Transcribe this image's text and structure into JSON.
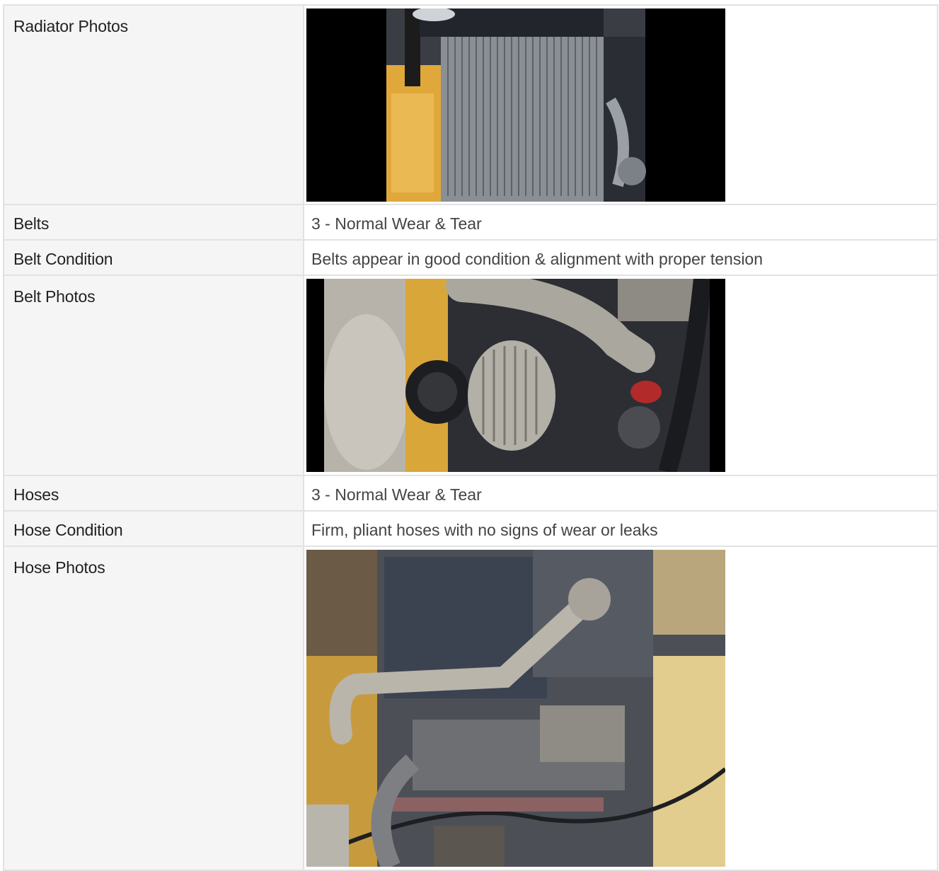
{
  "rows": {
    "radiator_photos": {
      "label": "Radiator Photos"
    },
    "belts": {
      "label": "Belts",
      "value": "3 - Normal Wear & Tear"
    },
    "belt_condition": {
      "label": "Belt Condition",
      "value": "Belts appear in good condition & alignment with proper tension"
    },
    "belt_photos": {
      "label": "Belt Photos"
    },
    "hoses": {
      "label": "Hoses",
      "value": "3 - Normal Wear & Tear"
    },
    "hose_condition": {
      "label": "Hose Condition",
      "value": "Firm, pliant hoses with no signs of wear or leaks"
    },
    "hose_photos": {
      "label": "Hose Photos"
    }
  }
}
